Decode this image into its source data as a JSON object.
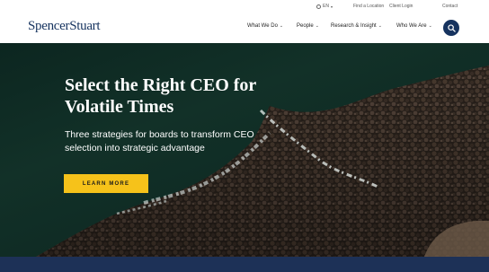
{
  "utility": {
    "language": "EN",
    "links": [
      "Find a Location",
      "Client Login",
      "Contact"
    ]
  },
  "header": {
    "logo": "SpencerStuart",
    "nav": [
      "What We Do",
      "People",
      "Research & Insight",
      "Who We Are"
    ],
    "search_icon": "search-icon"
  },
  "hero": {
    "headline": "Select the Right CEO for Volatile Times",
    "subhead": "Three strategies for boards to transform CEO selection into strategic advantage",
    "cta": "LEARN MORE"
  },
  "colors": {
    "brand_navy": "#16335f",
    "cta_yellow": "#f6c21a",
    "bottom_band": "#1d3157"
  }
}
